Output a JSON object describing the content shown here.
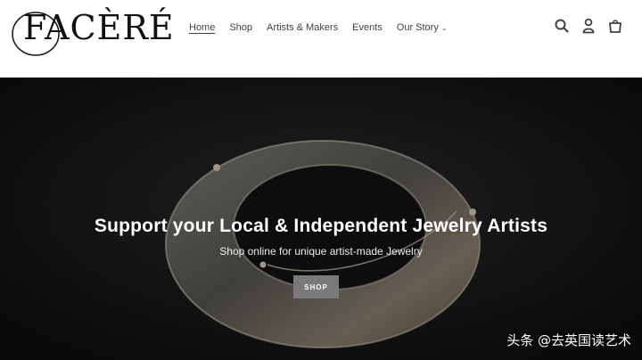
{
  "brand": {
    "logo_text": "FACÈRÉ"
  },
  "nav": {
    "items": [
      {
        "label": "Home",
        "active": true
      },
      {
        "label": "Shop",
        "active": false
      },
      {
        "label": "Artists & Makers",
        "active": false
      },
      {
        "label": "Events",
        "active": false
      },
      {
        "label": "Our Story",
        "active": false,
        "has_dropdown": true
      }
    ]
  },
  "header_icons": [
    "search-icon",
    "account-icon",
    "cart-icon"
  ],
  "hero": {
    "title": "Support your Local & Independent Jewelry Artists",
    "subtitle": "Shop online for unique artist-made Jewelry",
    "button_label": "SHOP"
  },
  "watermark": "头条 @去英国读艺术",
  "colors": {
    "hero_bg": "#151515",
    "button_bg": "#7a7a7a",
    "nav_text": "#3d4246"
  }
}
